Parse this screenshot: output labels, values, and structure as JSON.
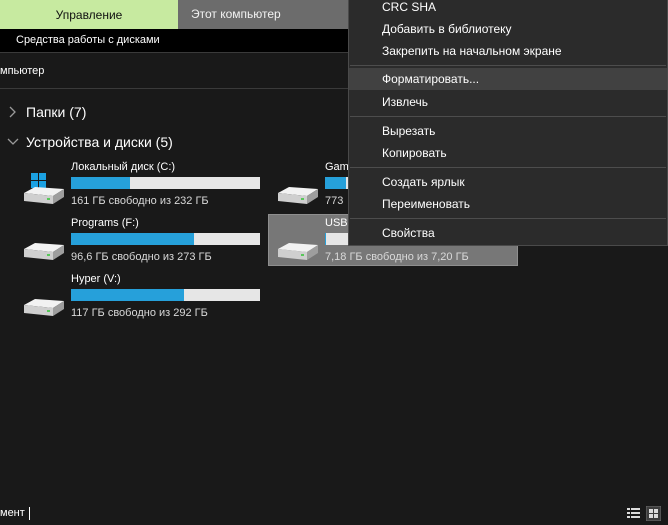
{
  "ribbon": {
    "tab_manage": "Управление",
    "tab_this_pc": "Этот компьютер",
    "subtab_drive_tools": "Средства работы с дисками"
  },
  "address": {
    "text": "мпьютер"
  },
  "groups": {
    "folders": "Папки (7)",
    "devices": "Устройства и диски (5)"
  },
  "drives": [
    {
      "name": "Локальный диск (C:)",
      "info": "161 ГБ свободно из 232 ГБ",
      "used_fraction": 0.31,
      "icon": "windows-drive-icon"
    },
    {
      "name": "Gam",
      "info": "773",
      "used_fraction": 0.11,
      "icon": "hard-drive-icon"
    },
    {
      "name": "Programs (F:)",
      "info": "96,6 ГБ свободно из 273 ГБ",
      "used_fraction": 0.65,
      "icon": "hard-drive-icon"
    },
    {
      "name": "USB",
      "info": "7,18 ГБ свободно из 7,20 ГБ",
      "used_fraction": 0.003,
      "icon": "usb-drive-icon",
      "selected": true
    },
    {
      "name": "Hyper (V:)",
      "info": "117 ГБ свободно из 292 ГБ",
      "used_fraction": 0.6,
      "icon": "hard-drive-icon"
    }
  ],
  "context_menu": {
    "items": [
      "CRC SHA",
      "Добавить в библиотеку",
      "Закрепить на начальном экране",
      "Форматировать...",
      "Извлечь",
      "Вырезать",
      "Копировать",
      "Создать ярлык",
      "Переименовать",
      "Свойства"
    ],
    "highlighted": "Форматировать..."
  },
  "status": {
    "text": "мент"
  },
  "colors": {
    "accent_bar": "#26a0da",
    "manage_tab": "#c7eaa0",
    "background": "#191919",
    "menu_bg": "#2b2b2b"
  }
}
